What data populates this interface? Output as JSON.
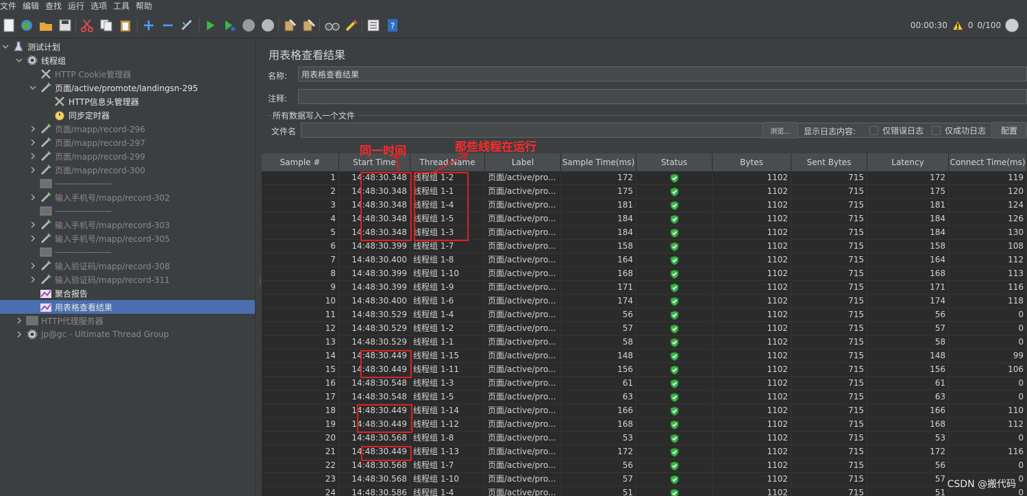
{
  "menu": [
    "文件",
    "编辑",
    "查找",
    "运行",
    "选项",
    "工具",
    "帮助"
  ],
  "toolbar": {
    "elapsed": "00:00:30",
    "warnings": "0",
    "threads": "0/100"
  },
  "tree": [
    {
      "label": "测试计划",
      "level": 0,
      "chev": "down",
      "icon": "flask-icon",
      "state": "active"
    },
    {
      "label": "线程组",
      "level": 1,
      "chev": "down",
      "icon": "gear-icon",
      "state": "active"
    },
    {
      "label": "HTTP Cookie管理器",
      "level": 2,
      "chev": "",
      "icon": "wrench-icon",
      "state": "disabled"
    },
    {
      "label": "页面/active/promote/landingsn-295",
      "level": 2,
      "chev": "down",
      "icon": "pipette-icon",
      "state": "active"
    },
    {
      "label": "HTTP信息头管理器",
      "level": 3,
      "chev": "",
      "icon": "wrench-icon",
      "state": "active"
    },
    {
      "label": "同步定时器",
      "level": 3,
      "chev": "",
      "icon": "stopwatch-icon",
      "state": "active"
    },
    {
      "label": "页面/mapp/record-296",
      "level": 2,
      "chev": "right",
      "icon": "pipette-icon",
      "state": "disabled"
    },
    {
      "label": "页面/mapp/record-297",
      "level": 2,
      "chev": "right",
      "icon": "pipette-icon",
      "state": "disabled"
    },
    {
      "label": "页面/mapp/record-299",
      "level": 2,
      "chev": "right",
      "icon": "pipette-icon",
      "state": "disabled"
    },
    {
      "label": "页面/mapp/record-300",
      "level": 2,
      "chev": "right",
      "icon": "pipette-icon",
      "state": "disabled"
    },
    {
      "label": "-------------------",
      "level": 2,
      "chev": "",
      "icon": "box-icon",
      "state": "disabled"
    },
    {
      "label": "输入手机号/mapp/record-302",
      "level": 2,
      "chev": "right",
      "icon": "pipette-icon",
      "state": "disabled"
    },
    {
      "label": "-------------------",
      "level": 2,
      "chev": "",
      "icon": "box-icon",
      "state": "disabled"
    },
    {
      "label": "输入手机号/mapp/record-303",
      "level": 2,
      "chev": "right",
      "icon": "pipette-icon",
      "state": "disabled"
    },
    {
      "label": "输入手机号/mapp/record-305",
      "level": 2,
      "chev": "right",
      "icon": "pipette-icon",
      "state": "disabled"
    },
    {
      "label": "-------------------",
      "level": 2,
      "chev": "",
      "icon": "box-icon",
      "state": "disabled"
    },
    {
      "label": "输入验证码/mapp/record-308",
      "level": 2,
      "chev": "right",
      "icon": "pipette-icon",
      "state": "disabled"
    },
    {
      "label": "输入验证码/mapp/record-311",
      "level": 2,
      "chev": "right",
      "icon": "pipette-icon",
      "state": "disabled"
    },
    {
      "label": "聚合报告",
      "level": 2,
      "chev": "",
      "icon": "report-icon",
      "state": "active"
    },
    {
      "label": "用表格查看结果",
      "level": 2,
      "chev": "",
      "icon": "report-icon",
      "state": "active",
      "selected": true
    },
    {
      "label": "HTTP代理服务器",
      "level": 1,
      "chev": "right",
      "icon": "box-icon",
      "state": "disabled"
    },
    {
      "label": "jp@gc - Ultimate Thread Group",
      "level": 1,
      "chev": "right",
      "icon": "gear-icon",
      "state": "disabled"
    }
  ],
  "panel": {
    "title": "用表格查看结果",
    "name_label": "名称:",
    "name_value": "用表格查看结果",
    "comment_label": "注释:",
    "comment_value": "",
    "group_title": "所有数据写入一个文件",
    "file_label": "文件名",
    "file_value": "",
    "browse_label": "浏览...",
    "log_label": "显示日志内容:",
    "errors_only": "仅错误日志",
    "success_only": "仅成功日志",
    "config_label": "配置"
  },
  "table": {
    "columns": [
      "Sample #",
      "Start Time",
      "Thread Name",
      "Label",
      "Sample Time(ms)",
      "Status",
      "Bytes",
      "Sent Bytes",
      "Latency",
      "Connect Time(ms)"
    ],
    "rows": [
      [
        "1",
        "14:48:30.348",
        "线程组 1-2",
        "页面/active/pro...",
        "172",
        "ok",
        "1102",
        "715",
        "172",
        "119"
      ],
      [
        "2",
        "14:48:30.348",
        "线程组 1-1",
        "页面/active/pro...",
        "175",
        "ok",
        "1102",
        "715",
        "175",
        "120"
      ],
      [
        "3",
        "14:48:30.348",
        "线程组 1-4",
        "页面/active/pro...",
        "181",
        "ok",
        "1102",
        "715",
        "181",
        "124"
      ],
      [
        "4",
        "14:48:30.348",
        "线程组 1-5",
        "页面/active/pro...",
        "184",
        "ok",
        "1102",
        "715",
        "184",
        "126"
      ],
      [
        "5",
        "14:48:30.348",
        "线程组 1-3",
        "页面/active/pro...",
        "184",
        "ok",
        "1102",
        "715",
        "184",
        "130"
      ],
      [
        "6",
        "14:48:30.399",
        "线程组 1-7",
        "页面/active/pro...",
        "158",
        "ok",
        "1102",
        "715",
        "158",
        "108"
      ],
      [
        "7",
        "14:48:30.400",
        "线程组 1-8",
        "页面/active/pro...",
        "164",
        "ok",
        "1102",
        "715",
        "164",
        "112"
      ],
      [
        "8",
        "14:48:30.399",
        "线程组 1-10",
        "页面/active/pro...",
        "168",
        "ok",
        "1102",
        "715",
        "168",
        "113"
      ],
      [
        "9",
        "14:48:30.399",
        "线程组 1-9",
        "页面/active/pro...",
        "171",
        "ok",
        "1102",
        "715",
        "171",
        "116"
      ],
      [
        "10",
        "14:48:30.400",
        "线程组 1-6",
        "页面/active/pro...",
        "174",
        "ok",
        "1102",
        "715",
        "174",
        "118"
      ],
      [
        "11",
        "14:48:30.529",
        "线程组 1-4",
        "页面/active/pro...",
        "56",
        "ok",
        "1102",
        "715",
        "56",
        "0"
      ],
      [
        "12",
        "14:48:30.529",
        "线程组 1-2",
        "页面/active/pro...",
        "57",
        "ok",
        "1102",
        "715",
        "57",
        "0"
      ],
      [
        "13",
        "14:48:30.529",
        "线程组 1-1",
        "页面/active/pro...",
        "58",
        "ok",
        "1102",
        "715",
        "58",
        "0"
      ],
      [
        "14",
        "14:48:30.449",
        "线程组 1-15",
        "页面/active/pro...",
        "148",
        "ok",
        "1102",
        "715",
        "148",
        "99"
      ],
      [
        "15",
        "14:48:30.449",
        "线程组 1-11",
        "页面/active/pro...",
        "156",
        "ok",
        "1102",
        "715",
        "156",
        "106"
      ],
      [
        "16",
        "14:48:30.548",
        "线程组 1-3",
        "页面/active/pro...",
        "61",
        "ok",
        "1102",
        "715",
        "61",
        "0"
      ],
      [
        "17",
        "14:48:30.548",
        "线程组 1-5",
        "页面/active/pro...",
        "63",
        "ok",
        "1102",
        "715",
        "63",
        "0"
      ],
      [
        "18",
        "14:48:30.449",
        "线程组 1-14",
        "页面/active/pro...",
        "166",
        "ok",
        "1102",
        "715",
        "166",
        "110"
      ],
      [
        "19",
        "14:48:30.449",
        "线程组 1-12",
        "页面/active/pro...",
        "168",
        "ok",
        "1102",
        "715",
        "168",
        "112"
      ],
      [
        "20",
        "14:48:30.568",
        "线程组 1-8",
        "页面/active/pro...",
        "53",
        "ok",
        "1102",
        "715",
        "53",
        "0"
      ],
      [
        "21",
        "14:48:30.449",
        "线程组 1-13",
        "页面/active/pro...",
        "172",
        "ok",
        "1102",
        "715",
        "172",
        "116"
      ],
      [
        "22",
        "14:48:30.568",
        "线程组 1-7",
        "页面/active/pro...",
        "56",
        "ok",
        "1102",
        "715",
        "56",
        "0"
      ],
      [
        "23",
        "14:48:30.568",
        "线程组 1-10",
        "页面/active/pro...",
        "57",
        "ok",
        "1102",
        "715",
        "57",
        "0"
      ],
      [
        "24",
        "14:48:30.586",
        "线程组 1-4",
        "页面/active/pro...",
        "51",
        "ok",
        "1102",
        "715",
        "51",
        "0"
      ]
    ]
  },
  "annotations": {
    "same_time": "同一时间",
    "threads_running": "那些线程在运行"
  },
  "watermark": "CSDN @搬代码",
  "colors": {
    "background": "#3c3f41",
    "selection": "#4b6eaf",
    "table_bg": "#2b2b2b",
    "annotation": "#e02020",
    "status_ok": "#3cb44b"
  }
}
